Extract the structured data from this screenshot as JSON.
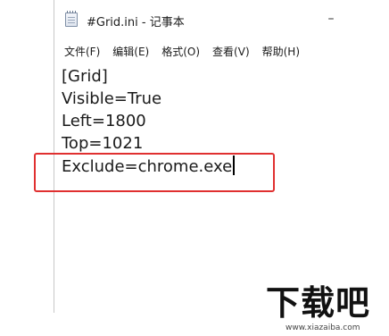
{
  "window": {
    "title": "#Grid.ini - 记事本",
    "minimize_symbol": "–"
  },
  "menu": {
    "items": [
      {
        "label": "文件(F)"
      },
      {
        "label": "编辑(E)"
      },
      {
        "label": "格式(O)"
      },
      {
        "label": "查看(V)"
      },
      {
        "label": "帮助(H)"
      }
    ]
  },
  "editor": {
    "lines": [
      "[Grid]",
      "Visible=True",
      "Left=1800",
      "Top=1021",
      "Exclude=chrome.exe"
    ]
  },
  "annotation": {
    "highlight_color": "#e03030"
  },
  "watermark": {
    "logo_text": "下载吧",
    "url": "www.xiazaiba.com"
  }
}
